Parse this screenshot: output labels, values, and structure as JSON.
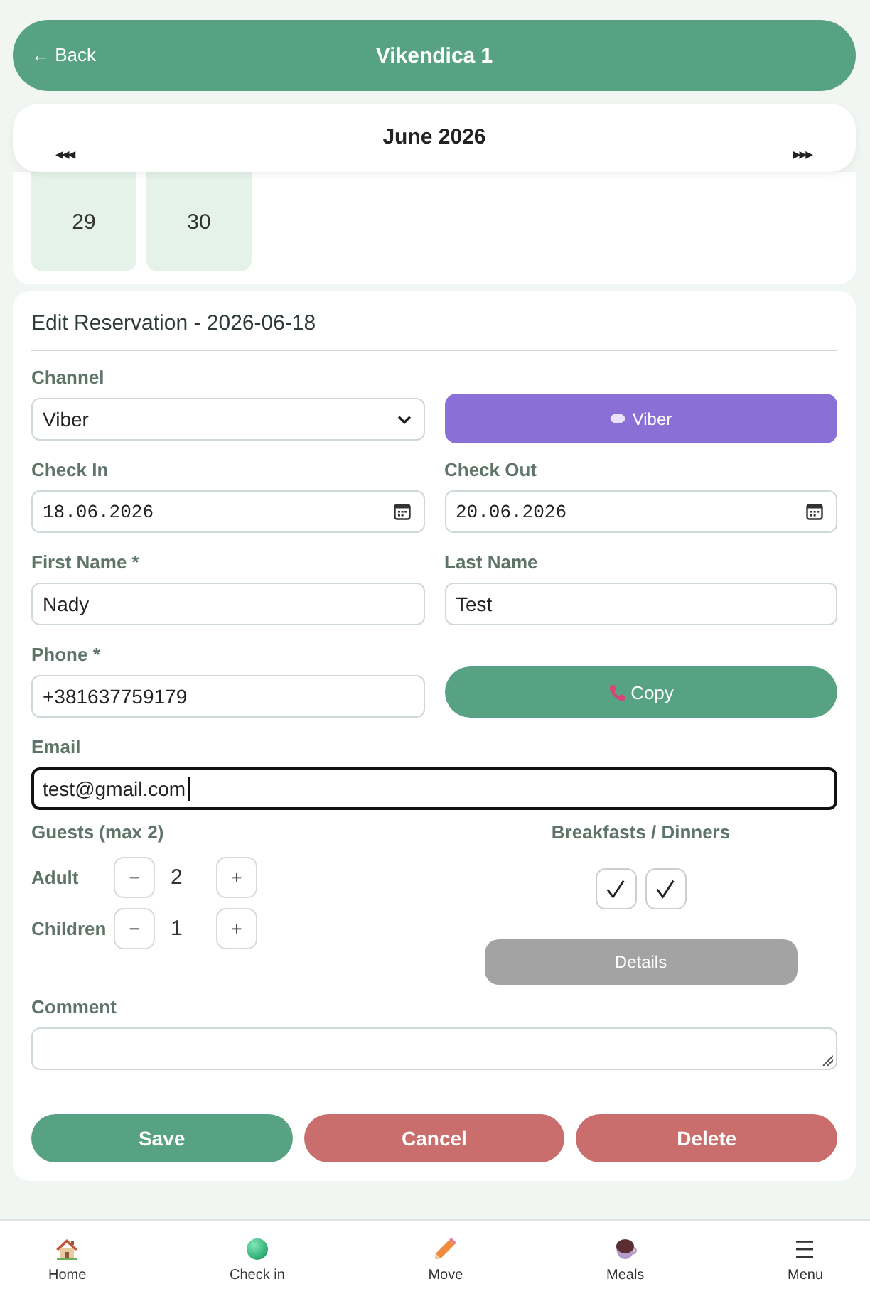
{
  "header": {
    "back": "← Back",
    "title": "Vikendica 1"
  },
  "calendar": {
    "prev": "◀◀◀",
    "month": "June 2026",
    "next": "▶▶▶",
    "days": [
      "29",
      "30"
    ]
  },
  "form": {
    "title": "Edit Reservation - 2026-06-18",
    "channel": {
      "label": "Channel",
      "value": "Viber"
    },
    "channel_button": {
      "label": "Viber"
    },
    "check_in": {
      "label": "Check In",
      "value": "18.06.2026"
    },
    "check_out": {
      "label": "Check Out",
      "value": "20.06.2026"
    },
    "first_name": {
      "label": "First Name *",
      "value": "Nady"
    },
    "last_name": {
      "label": "Last Name",
      "value": "Test"
    },
    "phone": {
      "label": "Phone *",
      "value": "+381637759179"
    },
    "copy_button": {
      "label": "Copy"
    },
    "email": {
      "label": "Email",
      "value": "test@gmail.com",
      "focused": true
    },
    "guests": {
      "label": "Guests (max 2)",
      "rows": [
        {
          "label": "Adult",
          "minus": "−",
          "value": "2",
          "plus": "+"
        },
        {
          "label": "Children",
          "minus": "−",
          "value": "1",
          "plus": "+"
        }
      ]
    },
    "meals": {
      "label": "Breakfasts / Dinners",
      "options": [
        {
          "checked": true
        },
        {
          "checked": true
        }
      ],
      "details_button": "Details"
    },
    "comment": {
      "label": "Comment"
    },
    "actions": [
      {
        "label": "Save",
        "kind": "primary"
      },
      {
        "label": "Cancel",
        "kind": "danger"
      },
      {
        "label": "Delete",
        "kind": "danger"
      }
    ]
  },
  "bottom_nav": [
    {
      "label": "Home"
    },
    {
      "label": "Check in"
    },
    {
      "label": "Move"
    },
    {
      "label": "Meals"
    },
    {
      "label": "Menu"
    }
  ]
}
